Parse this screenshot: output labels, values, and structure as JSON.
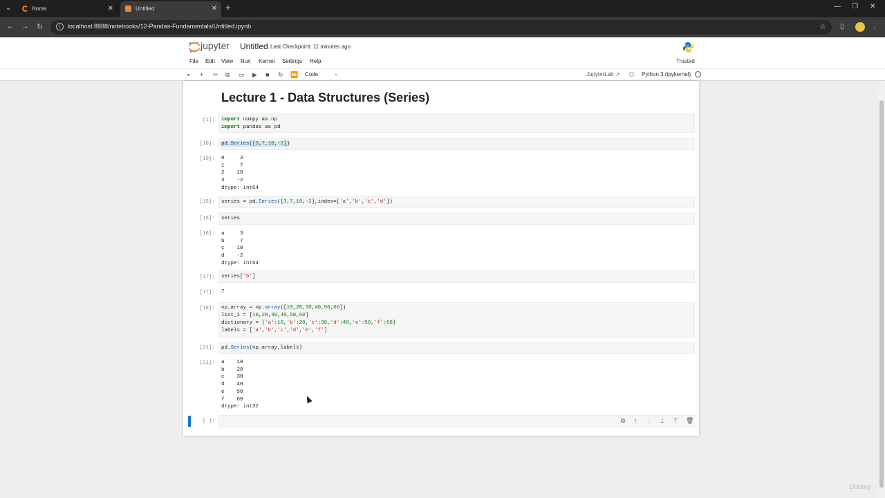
{
  "browser": {
    "tabs": [
      {
        "label": "Home"
      },
      {
        "label": "Untitled"
      }
    ],
    "url": "localhost:8888/notebooks/12-Pandas-Fundamentals/Untitled.ipynb"
  },
  "jupyter": {
    "logo_text": "jupyter",
    "notebook_name": "Untitled",
    "checkpoint": "Last Checkpoint: 11 minutes ago",
    "trusted": "Trusted",
    "menu": [
      "File",
      "Edit",
      "View",
      "Run",
      "Kernel",
      "Settings",
      "Help"
    ],
    "cell_type": "Code",
    "jupyterlab_link": "JupyterLab",
    "kernel": "Python 3 (ipykernel)"
  },
  "notebook": {
    "heading": "Lecture 1 - Data Structures (Series)",
    "cells": [
      {
        "prompt": "[1]:",
        "code": [
          "import numpy as np",
          "import pandas as pd"
        ]
      },
      {
        "prompt": "[10]:",
        "code": [
          "pd.Series([3,7,10,-2])"
        ]
      },
      {
        "prompt": "[10]:",
        "output": [
          "0     3",
          "1     7",
          "2    10",
          "3    -2",
          "dtype: int64"
        ]
      },
      {
        "prompt": "[15]:",
        "code": [
          "series = pd.Series([3,7,10,-2],index=['a','b','c','d'])"
        ]
      },
      {
        "prompt": "[16]:",
        "code": [
          "series"
        ]
      },
      {
        "prompt": "[16]:",
        "output": [
          "a     3",
          "b     7",
          "c    10",
          "d    -2",
          "dtype: int64"
        ]
      },
      {
        "prompt": "[17]:",
        "code": [
          "series['b']"
        ]
      },
      {
        "prompt": "[17]:",
        "output": [
          "7"
        ]
      },
      {
        "prompt": "[18]:",
        "code": [
          "np_array = np.array([10,20,30,40,50,60])",
          "list_1 = [10,20,30,40,50,60]",
          "dictionary = {'a':10,'b':20,'c':30,'d':40,'e':50,'f':60}",
          "labels = ['a','b','c','d','e','f']"
        ]
      },
      {
        "prompt": "[21]:",
        "code": [
          "pd.Series(np_array,labels)"
        ]
      },
      {
        "prompt": "[21]:",
        "output": [
          "a    10",
          "b    20",
          "c    30",
          "d    40",
          "e    50",
          "f    60",
          "dtype: int32"
        ]
      },
      {
        "prompt": "[ ]:",
        "code": [
          ""
        ]
      }
    ]
  },
  "watermark": "Udemy"
}
